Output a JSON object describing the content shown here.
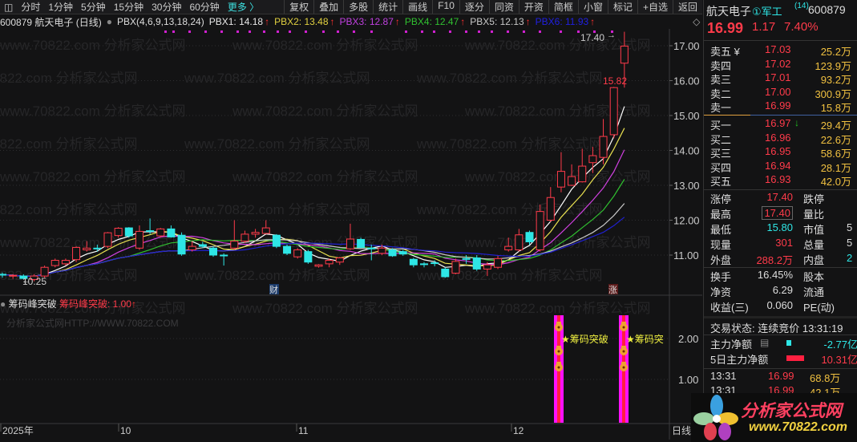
{
  "toolbar": {
    "left": [
      "分时",
      "1分钟",
      "5分钟",
      "15分钟",
      "30分钟",
      "60分钟"
    ],
    "more": "更多 〉",
    "right": [
      "复权",
      "叠加",
      "多股",
      "统计",
      "画线",
      "F10",
      "逐分",
      "同资",
      "开资",
      "简框",
      "小窗",
      "标记",
      "+自选",
      "返回"
    ]
  },
  "info": {
    "title": "600879 航天电子 (日线)",
    "indicator": "PBX(4,6,9,13,18,24)",
    "pbx": [
      {
        "label": "PBX1: 14.18",
        "color": "#e8e8e8"
      },
      {
        "label": "PBX2: 13.48",
        "color": "#e0d040"
      },
      {
        "label": "PBX3: 12.87",
        "color": "#c040e0"
      },
      {
        "label": "PBX4: 12.47",
        "color": "#30c030"
      },
      {
        "label": "PBX5: 12.13",
        "color": "#c8c8c8"
      },
      {
        "label": "PBX6: 11.93",
        "color": "#2020e0"
      }
    ],
    "arrow": "↑"
  },
  "chart_data": {
    "type": "candlestick",
    "yticks": [
      "17.00",
      "16.00",
      "15.00",
      "14.00",
      "13.00",
      "12.00",
      "11.00"
    ],
    "ylim": [
      10.2,
      17.5
    ],
    "high_label": "17.40",
    "low_label": "10.25",
    "mid_label": "15.82",
    "badges": [
      "财",
      "涨"
    ],
    "ma_colors": [
      "#ffffff",
      "#e8e050",
      "#d040e0",
      "#30c030",
      "#c8c8c8",
      "#2020d0"
    ],
    "ma_periods": [
      4,
      6,
      9,
      13,
      18,
      24
    ],
    "ohlc": [
      [
        10.45,
        10.5,
        10.35,
        10.43
      ],
      [
        10.4,
        10.45,
        10.32,
        10.42
      ],
      [
        10.4,
        10.45,
        10.3,
        10.33
      ],
      [
        10.3,
        10.45,
        10.25,
        10.4
      ],
      [
        10.4,
        10.7,
        10.35,
        10.65
      ],
      [
        10.7,
        10.9,
        10.65,
        10.85
      ],
      [
        10.75,
        10.9,
        10.7,
        10.85
      ],
      [
        10.87,
        11.25,
        10.8,
        11.22
      ],
      [
        11.15,
        11.4,
        11.1,
        11.2
      ],
      [
        11.2,
        11.3,
        11.1,
        11.18
      ],
      [
        11.25,
        11.66,
        11.2,
        11.64
      ],
      [
        11.56,
        11.8,
        11.5,
        11.77
      ],
      [
        11.78,
        11.8,
        11.5,
        11.55
      ],
      [
        11.2,
        11.85,
        11.15,
        11.68
      ],
      [
        11.7,
        12.05,
        11.6,
        11.68
      ],
      [
        11.55,
        11.78,
        11.5,
        11.75
      ],
      [
        11.75,
        11.85,
        11.5,
        11.52
      ],
      [
        11.57,
        11.65,
        10.98,
        11.03
      ],
      [
        11.15,
        11.4,
        11.1,
        11.25
      ],
      [
        11.3,
        11.38,
        11.2,
        11.25
      ],
      [
        11.2,
        11.25,
        10.95,
        11.0
      ],
      [
        11.0,
        11.05,
        10.7,
        10.98
      ],
      [
        11.2,
        12.0,
        11.15,
        11.4
      ],
      [
        11.4,
        11.7,
        11.35,
        11.6
      ],
      [
        11.6,
        11.75,
        11.5,
        11.65
      ],
      [
        11.62,
        12.0,
        11.6,
        11.78
      ],
      [
        11.57,
        11.6,
        11.2,
        11.25
      ],
      [
        11.25,
        11.3,
        11.0,
        11.05
      ],
      [
        10.95,
        11.2,
        10.9,
        11.15
      ],
      [
        11.1,
        11.15,
        10.75,
        10.8
      ],
      [
        10.68,
        10.74,
        10.64,
        10.72
      ],
      [
        10.75,
        10.9,
        10.65,
        10.85
      ],
      [
        10.8,
        10.95,
        10.72,
        10.92
      ],
      [
        11.18,
        11.9,
        11.15,
        11.46
      ],
      [
        11.45,
        11.5,
        11.2,
        11.22
      ],
      [
        11.2,
        11.3,
        10.85,
        11.18
      ],
      [
        11.05,
        11.3,
        11.0,
        11.2
      ],
      [
        11.15,
        11.2,
        10.95,
        10.98
      ],
      [
        11.1,
        11.15,
        10.98,
        11.03
      ],
      [
        10.88,
        10.92,
        10.65,
        10.72
      ],
      [
        10.75,
        10.8,
        10.65,
        10.73
      ],
      [
        10.78,
        10.85,
        10.68,
        10.76
      ],
      [
        10.6,
        10.65,
        10.35,
        10.38
      ],
      [
        10.48,
        10.9,
        10.45,
        10.82
      ],
      [
        10.9,
        11.0,
        10.75,
        10.88
      ],
      [
        10.92,
        11.0,
        10.55,
        10.6
      ],
      [
        10.6,
        10.8,
        10.4,
        10.72
      ],
      [
        10.65,
        10.98,
        10.6,
        10.9
      ],
      [
        11.15,
        11.5,
        11.1,
        11.25
      ],
      [
        11.15,
        11.75,
        11.1,
        11.58
      ],
      [
        11.65,
        11.7,
        11.3,
        11.38
      ],
      [
        11.15,
        12.45,
        11.1,
        12.25
      ],
      [
        12.0,
        12.95,
        11.95,
        12.65
      ],
      [
        12.95,
        13.95,
        12.8,
        13.4
      ],
      [
        13.0,
        13.6,
        12.98,
        13.25
      ],
      [
        13.1,
        14.05,
        13.08,
        13.55
      ],
      [
        13.65,
        14.1,
        13.35,
        13.85
      ],
      [
        13.8,
        14.9,
        13.6,
        14.4
      ],
      [
        14.45,
        15.82,
        14.35,
        15.8
      ],
      [
        16.5,
        17.4,
        15.8,
        16.99
      ]
    ],
    "xticks": [
      "2025年",
      "10",
      "11",
      "12"
    ],
    "period_label": "日线"
  },
  "lower": {
    "name": "筹码峰突破",
    "value_label": "筹码峰突破: 1.00",
    "watermark": "分析家公式网HTTP://WWW.70822.COM",
    "yticks": [
      "2.00",
      "1.00"
    ],
    "signal_text": "★筹码突破",
    "signal_text_clipped": "★筹码突",
    "signal_bars": [
      56,
      59
    ]
  },
  "panel": {
    "name": "航天电子",
    "tag": "①军工",
    "tag_count": "(14)",
    "code": "600879",
    "price": "16.99",
    "change": "1.17",
    "pct": "7.40%",
    "asks": [
      {
        "label": "卖五 ¥",
        "price": "17.03",
        "vol": "25.2万"
      },
      {
        "label": "卖四",
        "price": "17.02",
        "vol": "123.9万"
      },
      {
        "label": "卖三",
        "price": "17.01",
        "vol": "93.2万"
      },
      {
        "label": "卖二",
        "price": "17.00",
        "vol": "300.9万"
      },
      {
        "label": "卖一",
        "price": "16.99",
        "vol": "15.8万"
      }
    ],
    "bids": [
      {
        "label": "买一",
        "price": "16.97",
        "vol": "29.4万"
      },
      {
        "label": "买二",
        "price": "16.96",
        "vol": "22.6万"
      },
      {
        "label": "买三",
        "price": "16.95",
        "vol": "58.6万"
      },
      {
        "label": "买四",
        "price": "16.94",
        "vol": "28.1万"
      },
      {
        "label": "买五",
        "price": "16.93",
        "vol": "42.0万"
      }
    ],
    "stats": [
      {
        "l": "涨停",
        "v": "17.40",
        "c": "red",
        "r": "跌停",
        "rv": ""
      },
      {
        "l": "最高",
        "v": "17.40",
        "c": "red",
        "r": "量比",
        "rv": ""
      },
      {
        "l": "最低",
        "v": "15.80",
        "c": "cyan",
        "r": "市值",
        "rv": "5"
      },
      {
        "l": "现量",
        "v": "301",
        "c": "red",
        "r": "总量",
        "rv": "5"
      },
      {
        "l": "外盘",
        "v": "288.2万",
        "c": "red",
        "r": "内盘",
        "rv": "2"
      }
    ],
    "stats2": [
      {
        "l": "换手",
        "v": "16.45%",
        "r": "股本"
      },
      {
        "l": "净资",
        "v": "6.29",
        "r": "流通"
      },
      {
        "l": "收益(三)",
        "v": "0.060",
        "r": "PE(动)"
      }
    ],
    "trade_status": "交易状态: 连续竞价 13:31:19",
    "flow": [
      {
        "l": "主力净额",
        "v": "-2.77亿"
      },
      {
        "l": "5日主力净额",
        "v": "10.31亿"
      }
    ],
    "ticks": [
      {
        "t": "13:31",
        "p": "16.99",
        "v": "68.8万"
      },
      {
        "t": "13:31",
        "p": "16.99",
        "v": "42.1万"
      }
    ]
  },
  "logo": {
    "text": "分析家公式网",
    "url": "www.70822.com"
  },
  "watermark": "www.70822.com 分析家公式网"
}
